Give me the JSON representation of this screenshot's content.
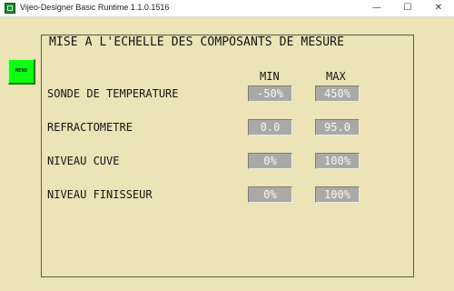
{
  "window": {
    "title": "Vijeo-Designer Basic Runtime 1.1.0.1516",
    "controls": {
      "minimize": "—",
      "maximize": "☐",
      "close": "✕"
    }
  },
  "screen": {
    "menu_label": "MENU",
    "title": "MISE A L'ECHELLE DES COMPOSANTS DE MESURE",
    "columns": {
      "min": "MIN",
      "max": "MAX"
    },
    "rows": [
      {
        "label": "SONDE DE TEMPERATURE",
        "min": "-50%",
        "max": "450%"
      },
      {
        "label": "REFRACTOMETRE",
        "min": "0.0",
        "max": "95.0"
      },
      {
        "label": "NIVEAU CUVE",
        "min": "0%",
        "max": "100%"
      },
      {
        "label": "NIVEAU FINISSEUR",
        "min": "0%",
        "max": "100%"
      }
    ]
  },
  "colors": {
    "background": "#ece3b7",
    "menu_button": "#10ff10",
    "value_field": "#aaa9a6"
  },
  "icons": {
    "app": "vijeo-app-icon"
  }
}
